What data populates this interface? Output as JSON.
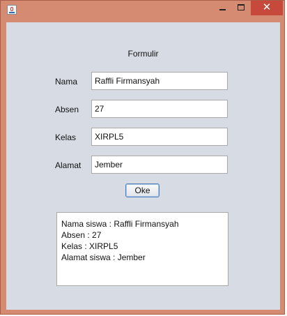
{
  "window": {
    "close_glyph": "✕"
  },
  "form": {
    "title": "Formulir",
    "fields": [
      {
        "label": "Nama",
        "value": "Raffli Firmansyah"
      },
      {
        "label": "Absen",
        "value": "27"
      },
      {
        "label": "Kelas",
        "value": "XIRPL5"
      },
      {
        "label": "Alamat",
        "value": "Jember"
      }
    ],
    "button_label": "Oke"
  },
  "output": {
    "lines": [
      "Nama siswa : Raffli Firmansyah",
      "Absen : 27",
      "Kelas : XIRPL5",
      "Alamat siswa : Jember"
    ]
  }
}
